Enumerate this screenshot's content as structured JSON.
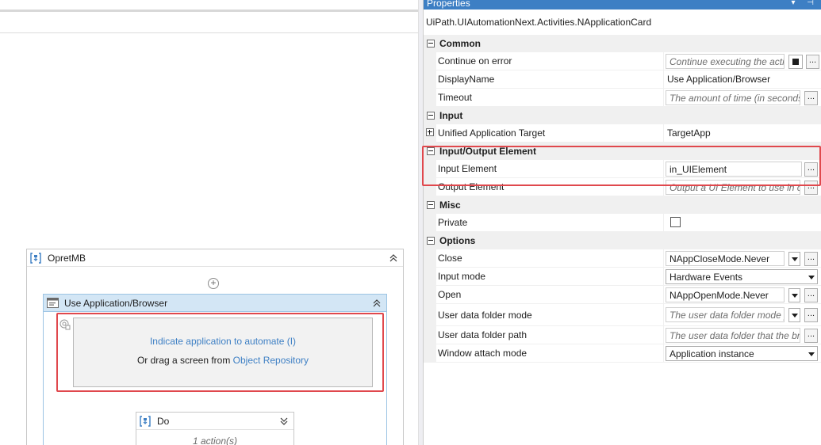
{
  "designer": {
    "sequence_title": "OpretMB",
    "use_app_title": "Use Application/Browser",
    "indicate_text": "Indicate application to automate (I)",
    "drag_prefix": "Or drag a screen from ",
    "drag_link": "Object Repository",
    "do_title": "Do",
    "do_actions": "1 action(s)"
  },
  "properties": {
    "panel_title": "Properties",
    "type_name": "UiPath.UIAutomationNext.Activities.NApplicationCard",
    "categories": {
      "common": "Common",
      "input": "Input",
      "io_element": "Input/Output Element",
      "misc": "Misc",
      "options": "Options"
    },
    "rows": {
      "continue_on_error": {
        "label": "Continue on error",
        "placeholder": "Continue executing the acti"
      },
      "display_name": {
        "label": "DisplayName",
        "value": "Use Application/Browser"
      },
      "timeout": {
        "label": "Timeout",
        "placeholder": "The amount of time (in seconds"
      },
      "unified_target": {
        "label": "Unified Application Target",
        "value": "TargetApp"
      },
      "input_element": {
        "label": "Input Element",
        "value": "in_UIElement"
      },
      "output_element": {
        "label": "Output Element",
        "placeholder": "Output a UI Element to use in c"
      },
      "private": {
        "label": "Private"
      },
      "close": {
        "label": "Close",
        "value": "NAppCloseMode.Never"
      },
      "input_mode": {
        "label": "Input mode",
        "value": "Hardware Events"
      },
      "open": {
        "label": "Open",
        "value": "NAppOpenMode.Never"
      },
      "user_data_folder_mode": {
        "label": "User data folder mode",
        "placeholder": "The user data folder mode y"
      },
      "user_data_folder_path": {
        "label": "User data folder path",
        "placeholder": "The user data folder that the br"
      },
      "window_attach_mode": {
        "label": "Window attach mode",
        "value": "Application instance"
      }
    },
    "dots_label": "...",
    "private_checked": false
  },
  "colors": {
    "accent": "#3d7fc4",
    "highlight_red": "#e0484d",
    "activity_header": "#d3e6f5"
  }
}
